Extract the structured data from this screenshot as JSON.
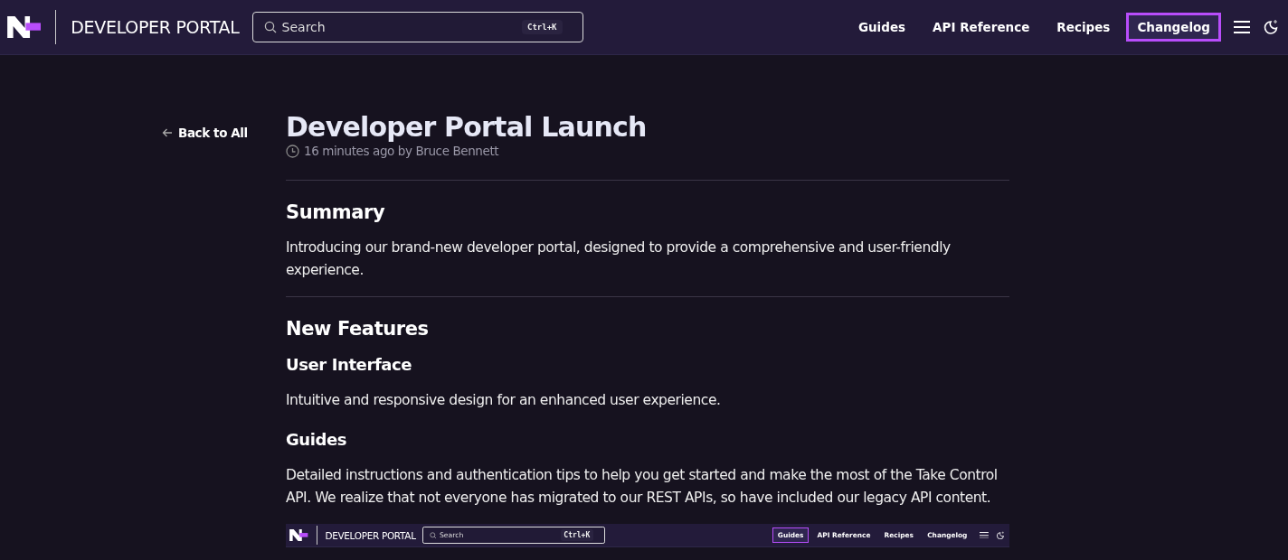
{
  "header": {
    "brand": "DEVELOPER PORTAL",
    "search": {
      "placeholder": "Search",
      "shortcut": "Ctrl+K"
    },
    "nav": [
      {
        "label": "Guides",
        "selected": false
      },
      {
        "label": "API Reference",
        "selected": false
      },
      {
        "label": "Recipes",
        "selected": false
      },
      {
        "label": "Changelog",
        "selected": true
      }
    ]
  },
  "back_link": "Back to All",
  "post": {
    "title": "Developer Portal Launch",
    "meta": "16 minutes ago by Bruce Bennett",
    "sections": [
      {
        "kind": "h2",
        "text": "Summary"
      },
      {
        "kind": "p",
        "text": "Introducing our brand-new developer portal, designed to provide a comprehensive and user-friendly experience."
      },
      {
        "kind": "rule"
      },
      {
        "kind": "h2",
        "text": "New Features"
      },
      {
        "kind": "h3",
        "text": "User Interface"
      },
      {
        "kind": "p",
        "text": "Intuitive and responsive design for an enhanced user experience."
      },
      {
        "kind": "h3",
        "text": "Guides"
      },
      {
        "kind": "p",
        "text": "Detailed instructions and authentication tips to help you get started and make the most of the Take Control API. We realize that not everyone has migrated to our REST APIs, so have included our legacy API content."
      }
    ]
  },
  "embedded_screenshot": {
    "brand": "DEVELOPER PORTAL",
    "search": {
      "placeholder": "Search",
      "shortcut": "Ctrl+K"
    },
    "nav": [
      {
        "label": "Guides",
        "selected": true
      },
      {
        "label": "API Reference",
        "selected": false
      },
      {
        "label": "Recipes",
        "selected": false
      },
      {
        "label": "Changelog",
        "selected": false
      }
    ]
  }
}
